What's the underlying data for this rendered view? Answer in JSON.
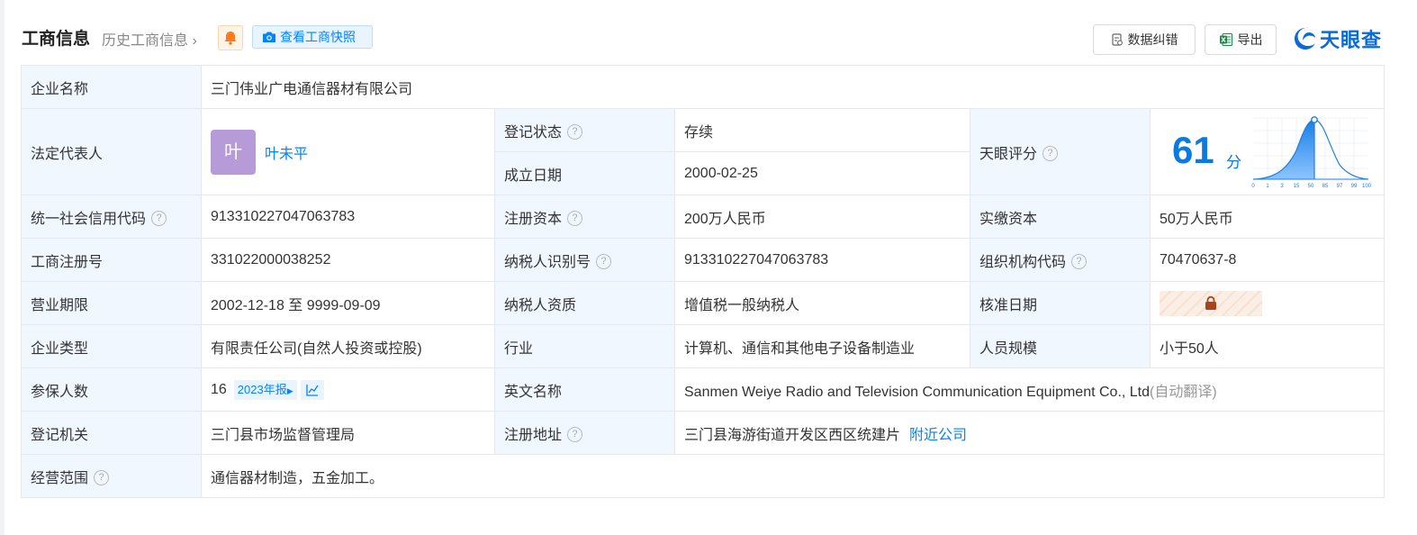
{
  "header": {
    "title": "工商信息",
    "history_link": "历史工商信息",
    "snapshot_label": "查看工商快照",
    "correct_label": "数据纠错",
    "export_label": "导出",
    "logo_text": "天眼查"
  },
  "colors": {
    "accent": "#0084ff",
    "label_bg": "#f0f7ff",
    "status_green": "#2e9e4e",
    "avatar": "#b79bd9"
  },
  "icons": {
    "bell": "bell-icon",
    "camera": "camera-icon",
    "correct": "document-edit-icon",
    "export": "excel-icon",
    "help": "question-circle-icon",
    "lock": "lock-icon",
    "trend": "line-chart-icon"
  },
  "company": {
    "name_label": "企业名称",
    "name": "三门伟业广电通信器材有限公司",
    "legal_rep_label": "法定代表人",
    "legal_rep_avatar": "叶",
    "legal_rep": "叶未平",
    "reg_status_label": "登记状态",
    "reg_status": "存续",
    "founded_label": "成立日期",
    "founded": "2000-02-25",
    "score_label": "天眼评分",
    "score": "61",
    "score_unit": "分",
    "score_axis": [
      "0",
      "1",
      "3",
      "15",
      "50",
      "85",
      "97",
      "99",
      "100"
    ],
    "credit_code_label": "统一社会信用代码",
    "credit_code": "913310227047063783",
    "reg_capital_label": "注册资本",
    "reg_capital": "200万人民币",
    "paid_capital_label": "实缴资本",
    "paid_capital": "50万人民币",
    "biz_reg_no_label": "工商注册号",
    "biz_reg_no": "331022000038252",
    "taxpayer_id_label": "纳税人识别号",
    "taxpayer_id": "913310227047063783",
    "org_code_label": "组织机构代码",
    "org_code": "70470637-8",
    "term_label": "营业期限",
    "term": "2002-12-18 至 9999-09-09",
    "taxpayer_qual_label": "纳税人资质",
    "taxpayer_qual": "增值税一般纳税人",
    "approval_date_label": "核准日期",
    "type_label": "企业类型",
    "type": "有限责任公司(自然人投资或控股)",
    "industry_label": "行业",
    "industry": "计算机、通信和其他电子设备制造业",
    "staff_label": "人员规模",
    "staff": "小于50人",
    "insured_label": "参保人数",
    "insured": "16",
    "insured_report": "2023年报",
    "english_name_label": "英文名称",
    "english_name": "Sanmen Weiye Radio and Television Communication Equipment Co., Ltd",
    "auto_translate": "(自动翻译)",
    "authority_label": "登记机关",
    "authority": "三门县市场监督管理局",
    "address_label": "注册地址",
    "address": "三门县海游街道开发区西区统建片",
    "nearby_link": "附近公司",
    "scope_label": "经营范围",
    "scope": "通信器材制造，五金加工。"
  }
}
